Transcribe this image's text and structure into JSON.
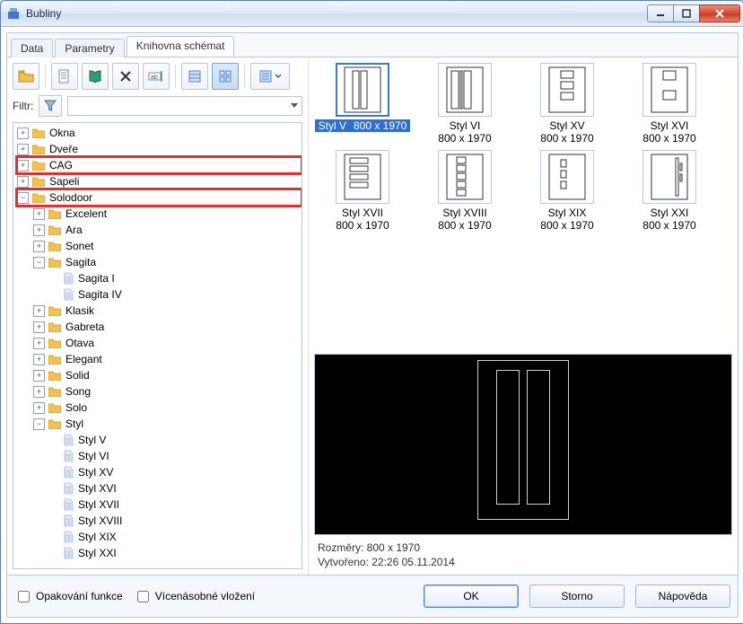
{
  "window": {
    "title": "Bubliny"
  },
  "tabs": [
    {
      "label": "Data",
      "active": false
    },
    {
      "label": "Parametry",
      "active": false
    },
    {
      "label": "Knihovna schémat",
      "active": true
    }
  ],
  "toolbar": {
    "icons": [
      "open-folder",
      "new-doc",
      "book",
      "delete",
      "rename",
      "sep",
      "grid-view",
      "thumb-view",
      "sep",
      "options"
    ]
  },
  "filter": {
    "label": "Filtr:",
    "value": ""
  },
  "tree": [
    {
      "type": "folder",
      "label": "Okna",
      "exp": "plus"
    },
    {
      "type": "folder",
      "label": "Dveře",
      "exp": "plus"
    },
    {
      "type": "folder",
      "label": "CAG",
      "exp": "plus",
      "highlight": true
    },
    {
      "type": "folder",
      "label": "Sapeli",
      "exp": "plus"
    },
    {
      "type": "folder",
      "label": "Solodoor",
      "exp": "minus",
      "highlight": true,
      "children": [
        {
          "type": "folder",
          "label": "Excelent",
          "exp": "plus"
        },
        {
          "type": "folder",
          "label": "Ara",
          "exp": "plus"
        },
        {
          "type": "folder",
          "label": "Sonet",
          "exp": "plus"
        },
        {
          "type": "folder",
          "label": "Sagita",
          "exp": "minus",
          "children": [
            {
              "type": "leaf",
              "label": "Sagita I"
            },
            {
              "type": "leaf",
              "label": "Sagita IV"
            }
          ]
        },
        {
          "type": "folder",
          "label": "Klasik",
          "exp": "plus"
        },
        {
          "type": "folder",
          "label": "Gabreta",
          "exp": "plus"
        },
        {
          "type": "folder",
          "label": "Otava",
          "exp": "plus"
        },
        {
          "type": "folder",
          "label": "Elegant",
          "exp": "plus"
        },
        {
          "type": "folder",
          "label": "Solid",
          "exp": "plus"
        },
        {
          "type": "folder",
          "label": "Song",
          "exp": "plus"
        },
        {
          "type": "folder",
          "label": "Solo",
          "exp": "plus"
        },
        {
          "type": "folder",
          "label": "Styl",
          "exp": "minus",
          "children": [
            {
              "type": "leaf",
              "label": "Styl V"
            },
            {
              "type": "leaf",
              "label": "Styl VI"
            },
            {
              "type": "leaf",
              "label": "Styl XV"
            },
            {
              "type": "leaf",
              "label": "Styl XVI"
            },
            {
              "type": "leaf",
              "label": "Styl XVII"
            },
            {
              "type": "leaf",
              "label": "Styl XVIII"
            },
            {
              "type": "leaf",
              "label": "Styl XIX"
            },
            {
              "type": "leaf",
              "label": "Styl XXI"
            }
          ]
        }
      ]
    }
  ],
  "thumbs": [
    {
      "label": "Styl V",
      "dims": "800 x 1970",
      "pattern": "v",
      "selected": true
    },
    {
      "label": "Styl VI",
      "dims": "800 x 1970",
      "pattern": "vi"
    },
    {
      "label": "Styl XV",
      "dims": "800 x 1970",
      "pattern": "xv"
    },
    {
      "label": "Styl XVI",
      "dims": "800 x 1970",
      "pattern": "xvi"
    },
    {
      "label": "Styl XVII",
      "dims": "800 x 1970",
      "pattern": "xvii"
    },
    {
      "label": "Styl XVIII",
      "dims": "800 x 1970",
      "pattern": "xviii"
    },
    {
      "label": "Styl XIX",
      "dims": "800 x 1970",
      "pattern": "xix"
    },
    {
      "label": "Styl XXI",
      "dims": "800 x 1970",
      "pattern": "xxi"
    }
  ],
  "meta": {
    "dims_label": "Rozměry: 800 x 1970",
    "created_label": "Vytvořeno: 22:26 05.11.2014"
  },
  "bottom": {
    "repeat": "Opakování funkce",
    "multi": "Vícenásobné vložení",
    "ok": "OK",
    "cancel": "Storno",
    "help": "Nápověda"
  }
}
